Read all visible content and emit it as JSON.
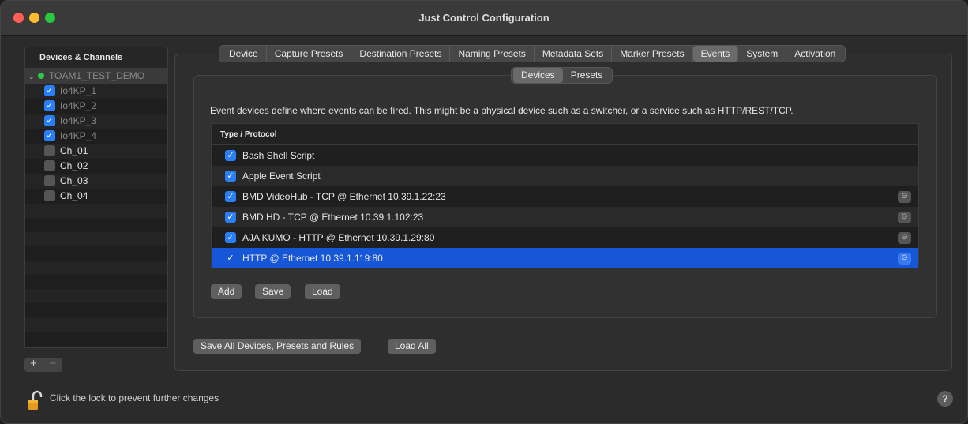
{
  "window": {
    "title": "Just Control Configuration"
  },
  "sidebar": {
    "header": "Devices & Channels",
    "root": {
      "label": "TOAM1_TEST_DEMO",
      "status_color": "#2ac64f"
    },
    "children": [
      {
        "label": "Io4KP_1",
        "checked": true
      },
      {
        "label": "Io4KP_2",
        "checked": true
      },
      {
        "label": "Io4KP_3",
        "checked": true
      },
      {
        "label": "Io4KP_4",
        "checked": true
      },
      {
        "label": "Ch_01",
        "checked": false
      },
      {
        "label": "Ch_02",
        "checked": false
      },
      {
        "label": "Ch_03",
        "checked": false
      },
      {
        "label": "Ch_04",
        "checked": false
      }
    ],
    "add_label": "+",
    "remove_label": "−"
  },
  "tabs": [
    {
      "label": "Device"
    },
    {
      "label": "Capture Presets"
    },
    {
      "label": "Destination Presets"
    },
    {
      "label": "Naming Presets"
    },
    {
      "label": "Metadata Sets"
    },
    {
      "label": "Marker Presets"
    },
    {
      "label": "Events",
      "active": true
    },
    {
      "label": "System"
    },
    {
      "label": "Activation"
    }
  ],
  "subtabs": [
    {
      "label": "Devices",
      "active": true
    },
    {
      "label": "Presets"
    }
  ],
  "events": {
    "description": "Event devices define where events can be fired. This might be a physical device such as a switcher, or a service such as HTTP/REST/TCP.",
    "column_header": "Type / Protocol",
    "rows": [
      {
        "label": "Bash Shell Script",
        "checked": true,
        "removable": false
      },
      {
        "label": "Apple Event Script",
        "checked": true,
        "removable": false
      },
      {
        "label": "BMD VideoHub - TCP @ Ethernet 10.39.1.22:23",
        "checked": true,
        "removable": true
      },
      {
        "label": "BMD HD - TCP @ Ethernet 10.39.1.102:23",
        "checked": true,
        "removable": true
      },
      {
        "label": "AJA KUMO - HTTP @ Ethernet 10.39.1.29:80",
        "checked": true,
        "removable": true
      },
      {
        "label": "HTTP @ Ethernet 10.39.1.119:80",
        "checked": true,
        "removable": true,
        "selected": true
      }
    ],
    "add_label": "Add",
    "save_label": "Save",
    "load_label": "Load"
  },
  "footer": {
    "save_all_label": "Save All Devices, Presets and Rules",
    "load_all_label": "Load All",
    "lock_text": "Click the lock to prevent further changes",
    "help_label": "?"
  },
  "colors": {
    "accent": "#2a7ef6",
    "selection": "#1557d6"
  }
}
